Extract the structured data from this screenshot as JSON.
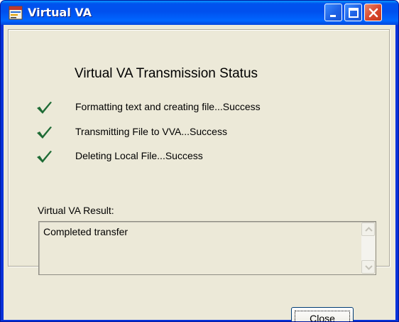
{
  "window": {
    "title": "Virtual VA",
    "controls": [
      "minimize-icon",
      "maximize-icon",
      "close-icon"
    ],
    "titlebar_color": "#0054e3",
    "close_color": "#d9462c"
  },
  "status": {
    "heading": "Virtual VA Transmission Status",
    "steps": [
      {
        "label": "Formatting text and creating file...Success",
        "icon": "checkmark-icon"
      },
      {
        "label": "Transmitting File to VVA...Success",
        "icon": "checkmark-icon"
      },
      {
        "label": "Deleting Local File...Success",
        "icon": "checkmark-icon"
      }
    ],
    "check_color": "#1e6b35"
  },
  "result": {
    "label": "Virtual VA Result:",
    "value": "Completed transfer"
  },
  "buttons": {
    "close_first": "C",
    "close_rest": "lose"
  }
}
